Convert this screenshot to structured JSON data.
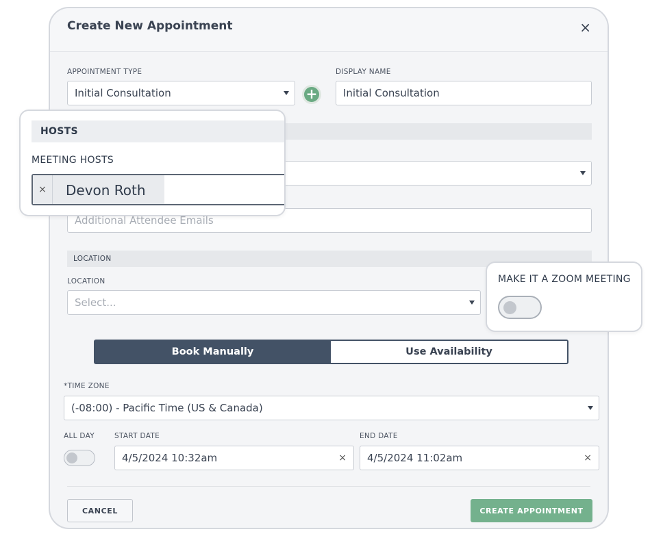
{
  "modal": {
    "title": "Create New Appointment",
    "close_glyph": "×"
  },
  "appointment_type": {
    "label": "APPOINTMENT TYPE",
    "value": "Initial Consultation",
    "add_glyph": "+"
  },
  "display_name": {
    "label": "DISPLAY NAME",
    "value": "Initial Consultation"
  },
  "attendees": {
    "placeholder": "Additional Attendee Emails"
  },
  "location_section": {
    "title": "LOCATION",
    "label": "LOCATION",
    "placeholder": "Select..."
  },
  "booking_mode": {
    "options": [
      "Book Manually",
      "Use Availability"
    ],
    "selected": "Book Manually"
  },
  "time_zone": {
    "label": "TIME ZONE",
    "required_mark": "*",
    "value": "(-08:00) - Pacific Time (US & Canada)"
  },
  "all_day": {
    "label": "ALL DAY",
    "enabled": false
  },
  "start_date": {
    "label": "START DATE",
    "value": "4/5/2024 10:32am",
    "clear_glyph": "×"
  },
  "end_date": {
    "label": "END DATE",
    "value": "4/5/2024 11:02am",
    "clear_glyph": "×"
  },
  "footer": {
    "cancel_label": "CANCEL",
    "create_label": "CREATE APPOINTMENT"
  },
  "hosts_callout": {
    "section_title": "HOSTS",
    "field_label": "MEETING HOSTS",
    "chips": [
      {
        "label": "Devon Roth",
        "remove_glyph": "×"
      }
    ]
  },
  "zoom_callout": {
    "label": "MAKE IT A ZOOM MEETING",
    "enabled": false
  },
  "colors": {
    "primary_dark": "#435266",
    "success_green": "#74b18d",
    "section_gray": "#e6e8eb"
  }
}
